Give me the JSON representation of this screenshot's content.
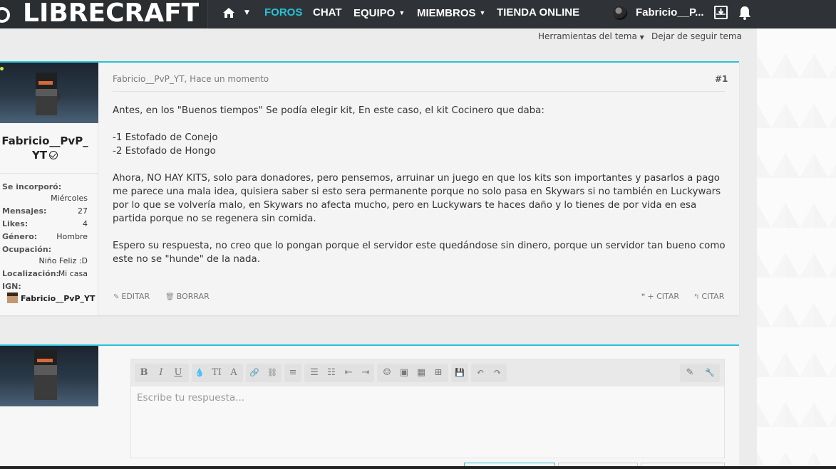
{
  "brand": {
    "name": "LIBRECRAFT"
  },
  "nav": {
    "items": [
      {
        "label": "FOROS",
        "active": true
      },
      {
        "label": "CHAT",
        "active": false
      },
      {
        "label": "EQUIPO",
        "active": false,
        "caret": "⌄"
      },
      {
        "label": "MIEMBROS",
        "active": false,
        "caret": "⌄"
      },
      {
        "label": "TIENDA ONLINE",
        "active": false
      }
    ],
    "home_icon": "home-icon",
    "user": {
      "name": "Fabricio__P..."
    },
    "icons": [
      "inbox-icon",
      "bell-icon"
    ]
  },
  "thread_tools": {
    "tools_label": "Herramientas del tema",
    "unfollow_label": "Dejar de seguir tema"
  },
  "post": {
    "author": "Fabricio__PvP_YT",
    "meta": "Fabricio__PvP_YT, Hace un momento",
    "number": "#1",
    "username_line1": "Fabricio__PvP_",
    "username_line2": "YT",
    "info": [
      {
        "key": "Se incorporó:",
        "value": ""
      },
      {
        "key": "",
        "value": "Miércoles"
      },
      {
        "key": "Mensajes:",
        "value": "27"
      },
      {
        "key": "Likes:",
        "value": "4"
      },
      {
        "key": "Género:",
        "value": "Hombre"
      },
      {
        "key": "Ocupación:",
        "value": ""
      },
      {
        "key": "",
        "value": "Niño Feliz :D"
      },
      {
        "key": "Localización:",
        "value": "Mi casa"
      },
      {
        "key": "IGN:",
        "value": ""
      }
    ],
    "ign": "Fabricio__PvP_YT",
    "body": [
      "Antes, en los \"Buenos tiempos\" Se podía elegir kit, En este caso, el kit Cocinero que daba:",
      "",
      "-1 Estofado de Conejo",
      "-2 Estofado de Hongo",
      "",
      "Ahora, NO HAY KITS, solo para donadores, pero pensemos, arruinar un juego en que los kits son importantes y pasarlos a pago me parece una mala idea, quisiera saber si esto sera permanente porque no solo pasa en Skywars si no también en Luckywars por lo que se volvería malo, en Skywars no afecta mucho, pero en Luckywars te haces daño y lo tienes de por vida en esa partida porque no se regenera sin comida.",
      "",
      "Espero su respuesta, no creo que lo pongan porque el servidor este quedándose sin dinero, porque un servidor tan bueno como este no se \"hunde\" de la nada."
    ],
    "actions": {
      "edit": "EDITAR",
      "delete": "BORRAR",
      "multiquote": "+ CITAR",
      "quote": "CITAR"
    }
  },
  "reply": {
    "placeholder": "Escribe tu respuesta...",
    "toolbar": [
      "B",
      "I",
      "U",
      "💧",
      "TI",
      "A",
      "🔗",
      "⛓",
      "≡",
      "☰",
      "☷",
      "⇤",
      "⇥",
      "☺",
      "▣",
      "▦",
      "⊞",
      "💾",
      "↶",
      "↷",
      "✎",
      "🔧"
    ]
  },
  "colors": {
    "accent": "#27c3d6",
    "navbar": "#2f3337"
  }
}
